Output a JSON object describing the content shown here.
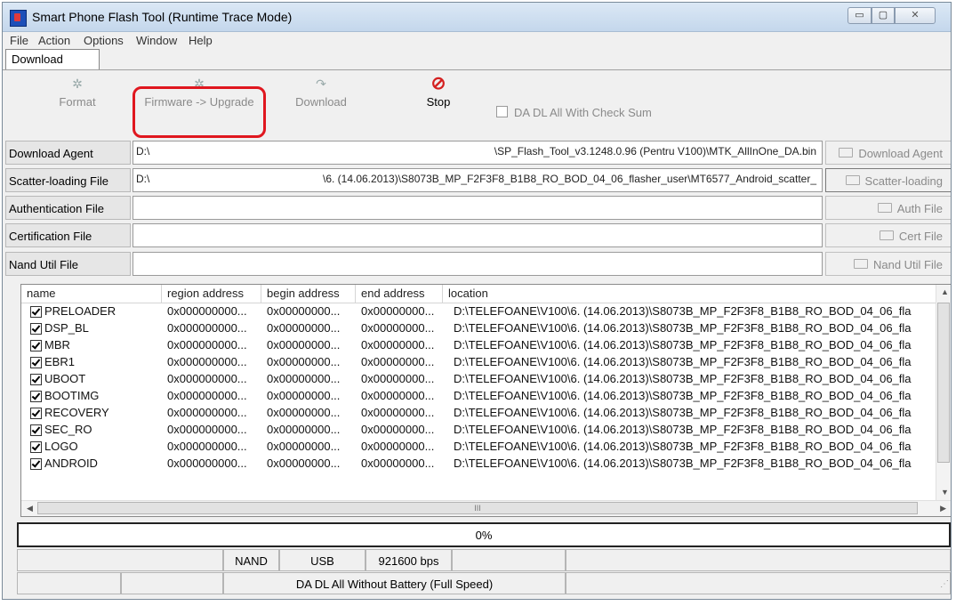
{
  "window": {
    "title": "Smart Phone Flash Tool (Runtime Trace Mode)",
    "controls": {
      "minimize": "▭",
      "maximize": "▢",
      "close": "✕"
    }
  },
  "menu": [
    "File",
    "Action",
    "Options",
    "Window",
    "Help"
  ],
  "tabs": [
    {
      "label": "Download",
      "active": true
    }
  ],
  "toolbar": {
    "format": {
      "label": "Format",
      "icon": "gear-icon",
      "enabled": false
    },
    "firmware_upgrade": {
      "label": "Firmware -> Upgrade",
      "icon": "gear-icon",
      "enabled": false,
      "highlighted": true
    },
    "download": {
      "label": "Download",
      "icon": "download-arrow-icon",
      "enabled": false
    },
    "stop": {
      "label": "Stop",
      "icon": "stop-icon",
      "enabled": true
    },
    "da_checksum": {
      "label": "DA DL All With Check Sum",
      "checked": false,
      "enabled": false
    }
  },
  "files": [
    {
      "label": "Download Agent",
      "drive": "D:\\",
      "path": "\\SP_Flash_Tool_v3.1248.0.96 (Pentru V100)\\MTK_AllInOne_DA.bin",
      "button": "Download Agent"
    },
    {
      "label": "Scatter-loading File",
      "drive": "D:\\",
      "path": "\\6. (14.06.2013)\\S8073B_MP_F2F3F8_B1B8_RO_BOD_04_06_flasher_user\\MT6577_Android_scatter_",
      "button": "Scatter-loading"
    },
    {
      "label": "Authentication File",
      "drive": "",
      "path": "",
      "button": "Auth File"
    },
    {
      "label": "Certification File",
      "drive": "",
      "path": "",
      "button": "Cert File"
    },
    {
      "label": "Nand Util File",
      "drive": "",
      "path": "",
      "button": "Nand Util File"
    }
  ],
  "partitions": {
    "columns": [
      "name",
      "region address",
      "begin address",
      "end address",
      "location"
    ],
    "rows": [
      {
        "name": "PRELOADER",
        "region": "0x000000000...",
        "begin": "0x00000000...",
        "end": "0x00000000...",
        "location": "D:\\TELEFOANE\\V100\\6. (14.06.2013)\\S8073B_MP_F2F3F8_B1B8_RO_BOD_04_06_fla"
      },
      {
        "name": "DSP_BL",
        "region": "0x000000000...",
        "begin": "0x00000000...",
        "end": "0x00000000...",
        "location": "D:\\TELEFOANE\\V100\\6. (14.06.2013)\\S8073B_MP_F2F3F8_B1B8_RO_BOD_04_06_fla"
      },
      {
        "name": "MBR",
        "region": "0x000000000...",
        "begin": "0x00000000...",
        "end": "0x00000000...",
        "location": "D:\\TELEFOANE\\V100\\6. (14.06.2013)\\S8073B_MP_F2F3F8_B1B8_RO_BOD_04_06_fla"
      },
      {
        "name": "EBR1",
        "region": "0x000000000...",
        "begin": "0x00000000...",
        "end": "0x00000000...",
        "location": "D:\\TELEFOANE\\V100\\6. (14.06.2013)\\S8073B_MP_F2F3F8_B1B8_RO_BOD_04_06_fla"
      },
      {
        "name": "UBOOT",
        "region": "0x000000000...",
        "begin": "0x00000000...",
        "end": "0x00000000...",
        "location": "D:\\TELEFOANE\\V100\\6. (14.06.2013)\\S8073B_MP_F2F3F8_B1B8_RO_BOD_04_06_fla"
      },
      {
        "name": "BOOTIMG",
        "region": "0x000000000...",
        "begin": "0x00000000...",
        "end": "0x00000000...",
        "location": "D:\\TELEFOANE\\V100\\6. (14.06.2013)\\S8073B_MP_F2F3F8_B1B8_RO_BOD_04_06_fla"
      },
      {
        "name": "RECOVERY",
        "region": "0x000000000...",
        "begin": "0x00000000...",
        "end": "0x00000000...",
        "location": "D:\\TELEFOANE\\V100\\6. (14.06.2013)\\S8073B_MP_F2F3F8_B1B8_RO_BOD_04_06_fla"
      },
      {
        "name": "SEC_RO",
        "region": "0x000000000...",
        "begin": "0x00000000...",
        "end": "0x00000000...",
        "location": "D:\\TELEFOANE\\V100\\6. (14.06.2013)\\S8073B_MP_F2F3F8_B1B8_RO_BOD_04_06_fla"
      },
      {
        "name": "LOGO",
        "region": "0x000000000...",
        "begin": "0x00000000...",
        "end": "0x00000000...",
        "location": "D:\\TELEFOANE\\V100\\6. (14.06.2013)\\S8073B_MP_F2F3F8_B1B8_RO_BOD_04_06_fla"
      },
      {
        "name": "ANDROID",
        "region": "0x000000000...",
        "begin": "0x00000000...",
        "end": "0x00000000...",
        "location": "D:\\TELEFOANE\\V100\\6. (14.06.2013)\\S8073B_MP_F2F3F8_B1B8_RO_BOD_04_06_fla"
      }
    ],
    "scroll_glyph": "III"
  },
  "progress": {
    "value": 0,
    "text": "0%"
  },
  "status": {
    "storage": "NAND",
    "port": "USB",
    "baud": "921600 bps",
    "mode": "DA DL All Without Battery (Full Speed)"
  },
  "colors": {
    "highlight": "#e0171f",
    "stop": "#d42020",
    "progress_fill": "#3a7bd5"
  }
}
